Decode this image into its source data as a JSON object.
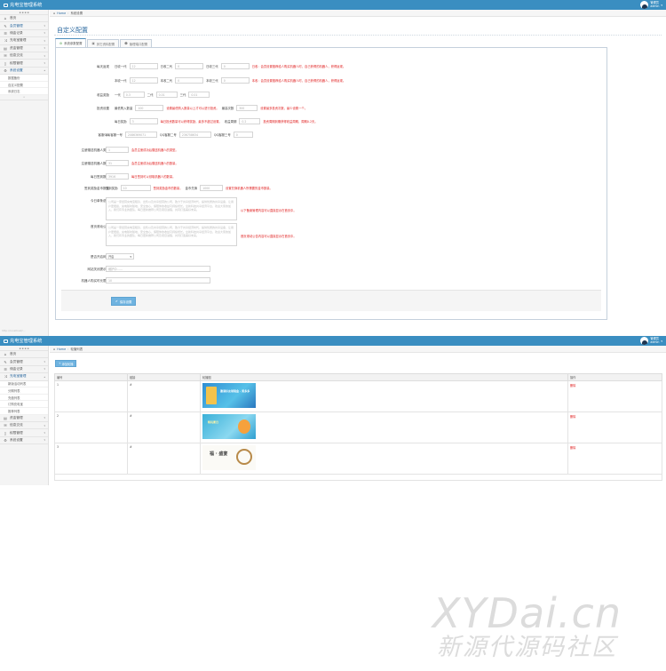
{
  "app": {
    "title": "充电宝管理系统",
    "user_role": "管理员",
    "user_name": "admin"
  },
  "sidebar1": {
    "items": [
      {
        "label": "首页",
        "icon": "home-icon"
      },
      {
        "label": "会员管理",
        "icon": "edit-icon"
      },
      {
        "label": "佣金记录",
        "icon": "list-icon"
      },
      {
        "label": "充电宝管理",
        "icon": "shuffle-icon"
      },
      {
        "label": "资金管理",
        "icon": "wallet-icon"
      },
      {
        "label": "信息交流",
        "icon": "chat-icon"
      },
      {
        "label": "权限管理",
        "icon": "doc-icon"
      },
      {
        "label": "系统设置",
        "icon": "settings-icon"
      }
    ],
    "sub_items": [
      "数据备份",
      "自定义配置",
      "系统日志"
    ]
  },
  "page1": {
    "breadcrumb": [
      "Home",
      "系统设置"
    ],
    "title": "自定义配置",
    "tabs": [
      "系统参数配置",
      "其它资料配置",
      "管理端口配置"
    ],
    "rows": {
      "earn": {
        "label": "每天返现",
        "a": [
          {
            "sub": "日收一代",
            "value": "12"
          },
          {
            "sub": "日收二代",
            "value": "0"
          },
          {
            "sub": "日收三代",
            "value": "0"
          }
        ],
        "hint_a": "日收：会员设置推荐给人购买机器人时，自己获得的机器人，获得返现。",
        "b": [
          {
            "sub": "本收一代",
            "value": "12"
          },
          {
            "sub": "本收二代",
            "value": "0"
          },
          {
            "sub": "本收三代",
            "value": "0"
          }
        ],
        "hint_b": "本收：会员设置推荐给人购买机器人时，自己获得的机器人，获得返现。"
      },
      "award": {
        "label": "收益奖励",
        "items": [
          {
            "sub": "一代",
            "value": "0.3"
          },
          {
            "sub": "二代",
            "value": "0.01"
          },
          {
            "sub": "三代",
            "value": "0.01"
          }
        ]
      },
      "invest": {
        "label": "投资设置",
        "sub1": "最低购入数量",
        "v1": "100",
        "hint1": "设置最低购入数量以上才可以进行投资。",
        "sub2": "最高次数",
        "v2": "300",
        "hint2": "设置最多投资次数，最少设置一个。"
      },
      "tax": {
        "label": "",
        "sub1": "每日奖励",
        "v1": "3",
        "hint1": "每日投资数量可以获得奖励，最多不超过设置。",
        "sub2": "收益周期",
        "v2": "0.2",
        "hint2": "投资周期到期获得收益周期，周期0.2天。"
      },
      "qq": {
        "label": "客服QQ",
        "items": [
          {
            "sub": "QQ客服一号",
            "value": "2086369071"
          },
          {
            "sub": "QQ客服二号",
            "value": "236758634"
          },
          {
            "sub": "QQ客服三号",
            "value": "0"
          }
        ]
      },
      "rows_simple": [
        {
          "label": "注册赠送机器人类型",
          "value": "1",
          "hint": "会员注册成功后赠送机器人的类型。"
        },
        {
          "label": "注册赠送机器人数量",
          "value": "31",
          "hint": "会员注册成功后赠送机器人的数量。"
        },
        {
          "label": "每日签到数量",
          "value": "3916",
          "hint": "每日签到可以领取机器人的数量。"
        }
      ],
      "sign": {
        "label": "签到奖励金币数量",
        "sub1": "签到奖励",
        "v1": "10",
        "hint1": "签到奖励金币的数量。",
        "sub2": "金币兑换",
        "v2": "1000",
        "hint2": "设置兑换机器人所需要的金币数量。"
      },
      "notice": {
        "label": "今日单条说明",
        "text": "公司是一家经营充电宝租赁、出售以及共享经营的公司，致力于共享经济时代，提供优质的共享设备，让用户更便捷，充电随时随地，安全放心，保障你的收益可持续增长。全新科技共享经济平台，欢迎大家的加入，我们有专业的团队，每日更新推荐公司及项目进程，共同打造美好未来。",
        "hint": "以下备案管理内容可以直接显示在首页中。"
      },
      "home_notice": {
        "label": "首页滚动公告",
        "text": "公司是一家经营充电宝租赁、出售以及共享经营的公司，致力于共享经济时代，提供优质的共享设备，让用户更便捷，充电随时随地，安全放心，保障你的收益可持续增长。全新科技共享经济平台，欢迎大家的加入，我们有专业的团队，每日更新推荐公司及项目进程，共同打造美好未来。",
        "hint": "首页滚动公告内容可以直接显示在首页中。"
      },
      "open": {
        "label": "是否开启网站",
        "value": "开启"
      },
      "close_msg": {
        "label": "网站关闭提示语",
        "placeholder": "维护中……"
      },
      "max_pay": {
        "label": "机器人购买时长限制",
        "value": "10"
      }
    },
    "save_label": "保存设置",
    "faint_note": "http://localhost/..."
  },
  "sidebar2": {
    "items": [
      {
        "label": "首页",
        "icon": "home-icon"
      },
      {
        "label": "会员管理",
        "icon": "edit-icon"
      },
      {
        "label": "佣金记录",
        "icon": "list-icon"
      },
      {
        "label": "充电宝管理",
        "icon": "shuffle-icon"
      }
    ],
    "sub_items": [
      "新版活动列表",
      "分期列表",
      "充值列表",
      "订购充电宝",
      "推荐列表"
    ],
    "items_after": [
      {
        "label": "资金管理",
        "icon": "wallet-icon"
      },
      {
        "label": "信息交流",
        "icon": "chat-icon"
      },
      {
        "label": "权限管理",
        "icon": "doc-icon"
      },
      {
        "label": "系统设置",
        "icon": "settings-icon"
      }
    ]
  },
  "page2": {
    "breadcrumb": [
      "Home",
      "轮播列表"
    ],
    "add_label": "添加轮播",
    "columns": [
      "编号",
      "链接",
      "轮播图",
      "操作"
    ],
    "rows": [
      {
        "id": "1",
        "link": "#",
        "image_text": "邀请好友领现金 · 奖多多",
        "action": "删除"
      },
      {
        "id": "2",
        "link": "#",
        "image_text": "畅玩夏日",
        "action": "删除"
      },
      {
        "id": "3",
        "link": "#",
        "image_text": "福 · 盛宴",
        "action": "删除"
      }
    ]
  },
  "watermark": {
    "big": "XYDai.cn",
    "small": "新源代源码社区"
  },
  "colors": {
    "navbar": "#3a8ec1",
    "link": "#2c6aa0",
    "hint": "#e02222",
    "button": "#6fb3e0"
  }
}
